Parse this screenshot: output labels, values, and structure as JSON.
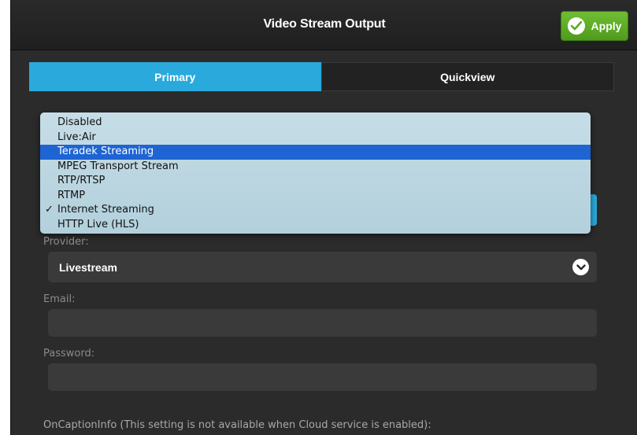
{
  "window": {
    "title": "Video Stream Output",
    "apply_label": "Apply"
  },
  "tabs": [
    {
      "label": "Primary",
      "active": true
    },
    {
      "label": "Quickview",
      "active": false
    }
  ],
  "mode_menu": {
    "items": [
      {
        "label": "Disabled",
        "checked": false,
        "highlighted": false
      },
      {
        "label": "Live:Air",
        "checked": false,
        "highlighted": false
      },
      {
        "label": "Teradek Streaming",
        "checked": false,
        "highlighted": true
      },
      {
        "label": "MPEG Transport Stream",
        "checked": false,
        "highlighted": false
      },
      {
        "label": "RTP/RTSP",
        "checked": false,
        "highlighted": false
      },
      {
        "label": "RTMP",
        "checked": false,
        "highlighted": false
      },
      {
        "label": "Internet Streaming",
        "checked": true,
        "highlighted": false
      },
      {
        "label": "HTTP Live (HLS)",
        "checked": false,
        "highlighted": false
      }
    ],
    "check_glyph": "✓"
  },
  "provider": {
    "label": "Provider:",
    "value": "Livestream"
  },
  "email": {
    "label": "Email:",
    "value": ""
  },
  "password": {
    "label": "Password:",
    "value": ""
  },
  "caption_note": "OnCaptionInfo (This setting is not available when Cloud service is enabled):",
  "colors": {
    "accent": "#29a9dc",
    "apply_green": "#5aab26",
    "menu_highlight": "#1e64d2",
    "panel_bg": "#2b2b2b"
  }
}
